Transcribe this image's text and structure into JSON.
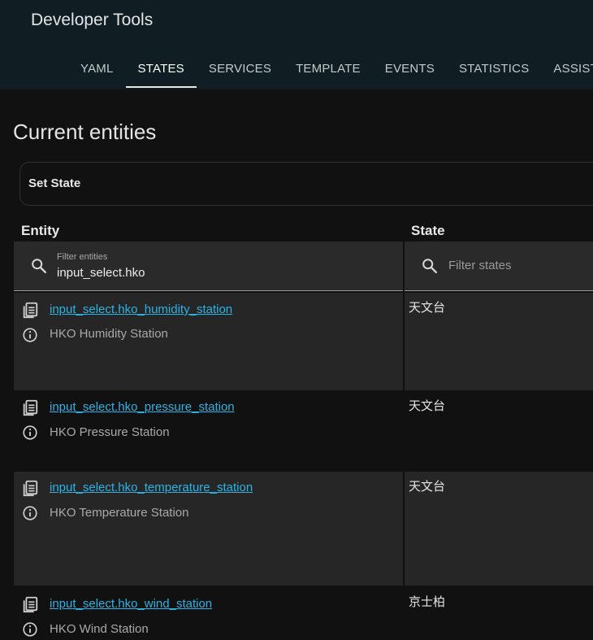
{
  "header": {
    "title": "Developer Tools",
    "tabs": [
      {
        "label": "YAML"
      },
      {
        "label": "STATES",
        "active": true
      },
      {
        "label": "SERVICES"
      },
      {
        "label": "TEMPLATE"
      },
      {
        "label": "EVENTS"
      },
      {
        "label": "STATISTICS"
      },
      {
        "label": "ASSIST"
      }
    ]
  },
  "main": {
    "page_title": "Current entities",
    "set_state_label": "Set State",
    "columns": {
      "entity": "Entity",
      "state": "State"
    },
    "entity_filter": {
      "label": "Filter entities",
      "value": "input_select.hko"
    },
    "state_filter": {
      "placeholder": "Filter states"
    },
    "rows": [
      {
        "entity_id": "input_select.hko_humidity_station",
        "friendly_name": "HKO Humidity Station",
        "state": "天文台"
      },
      {
        "entity_id": "input_select.hko_pressure_station",
        "friendly_name": "HKO Pressure Station",
        "state": "天文台"
      },
      {
        "entity_id": "input_select.hko_temperature_station",
        "friendly_name": "HKO Temperature Station",
        "state": "天文台"
      },
      {
        "entity_id": "input_select.hko_wind_station",
        "friendly_name": "HKO Wind Station",
        "state": "京士柏"
      }
    ]
  },
  "icons": {
    "search": "search-icon",
    "clipboard": "clipboard-list-icon",
    "info": "info-icon"
  },
  "colors": {
    "header_bg": "#101e24",
    "page_bg": "#111111",
    "link": "#2bb3e6",
    "alt_row": "#262626"
  }
}
